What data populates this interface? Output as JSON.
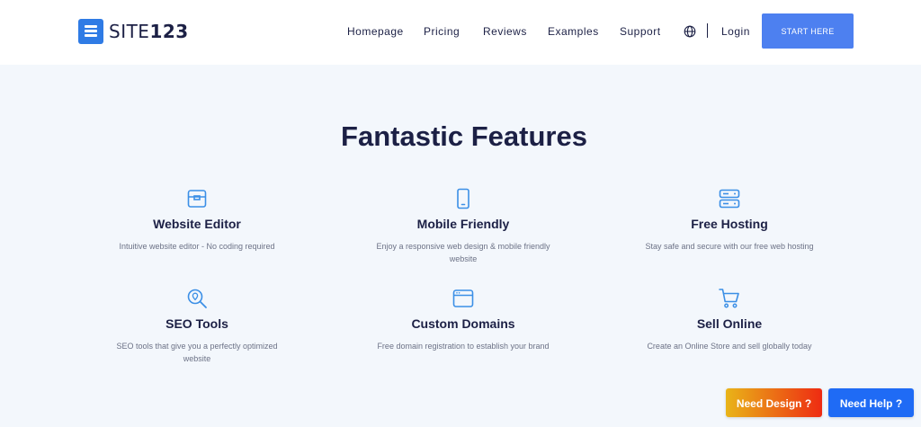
{
  "header": {
    "logo_text_light": "SITE",
    "logo_text_bold": "123",
    "nav": [
      "Homepage",
      "Pricing",
      "Reviews",
      "Examples",
      "Support"
    ],
    "language_icon": "globe-icon",
    "login_label": "Login",
    "cta_label": "START HERE"
  },
  "colors": {
    "brand": "#2f7be5",
    "cta": "#4d80f0",
    "heading": "#1c2045",
    "icon": "#3b8fe6",
    "page_bg": "#f3f7fc",
    "need_help_bg": "#1f6bf5"
  },
  "main": {
    "title": "Fantastic Features",
    "features": [
      {
        "icon": "box-icon",
        "title": "Website Editor",
        "desc": "Intuitive website editor - No coding required"
      },
      {
        "icon": "mobile-phone-icon",
        "title": "Mobile Friendly",
        "desc": "Enjoy a responsive web design & mobile friendly website"
      },
      {
        "icon": "server-icon",
        "title": "Free Hosting",
        "desc": "Stay safe and secure with our free web hosting"
      },
      {
        "icon": "seo-search-icon",
        "title": "SEO Tools",
        "desc": "SEO tools that give you a perfectly optimized website"
      },
      {
        "icon": "browser-window-icon",
        "title": "Custom Domains",
        "desc": "Free domain registration to establish your brand"
      },
      {
        "icon": "shopping-cart-icon",
        "title": "Sell Online",
        "desc": "Create an Online Store and sell globally today"
      }
    ]
  },
  "floating": {
    "need_design": "Need Design ?",
    "need_help": "Need Help ?"
  }
}
